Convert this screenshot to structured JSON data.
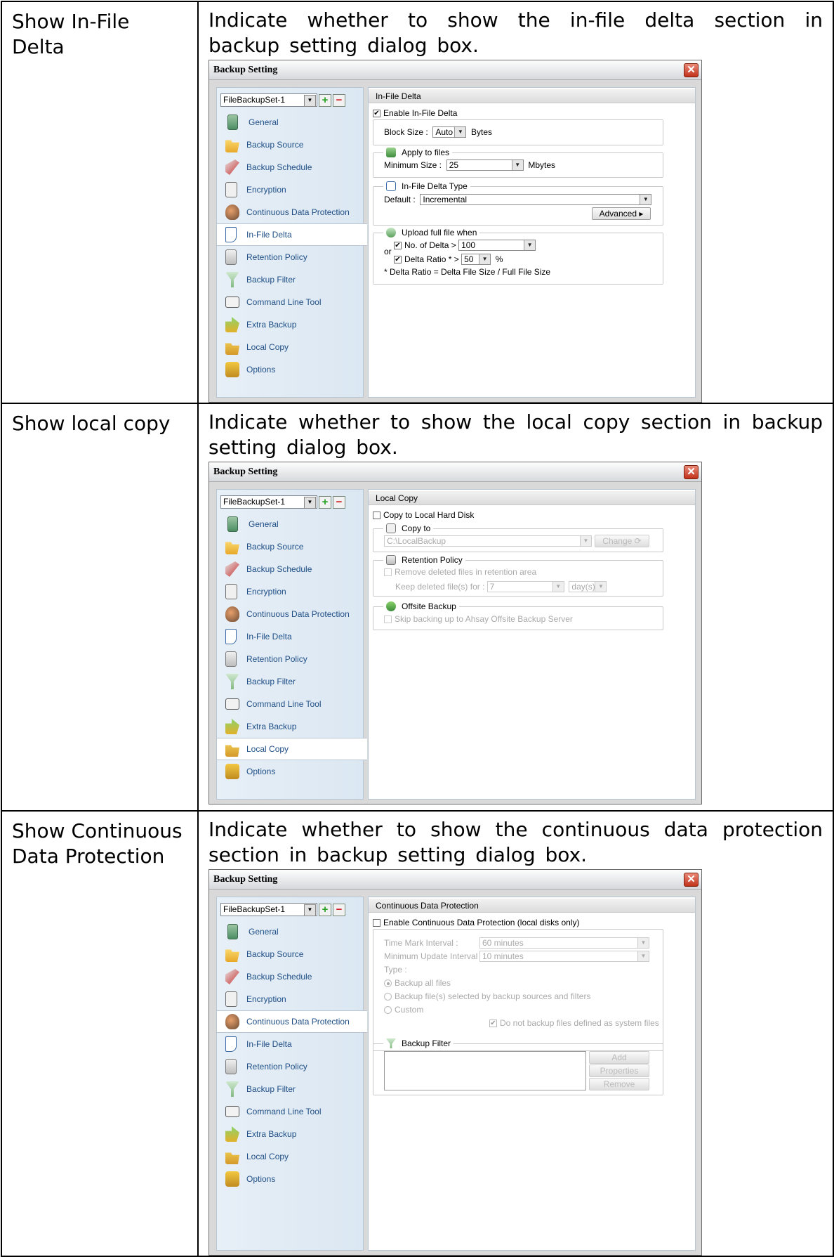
{
  "rows": [
    {
      "label": "Show In-File Delta",
      "desc_lines": [
        "Indicate whether to show the in-file delta section in",
        "backup setting dialog box."
      ],
      "dialog": {
        "title": "Backup Setting",
        "set_name": "FileBackupSet-1",
        "selected": "In-File Delta",
        "nav": [
          "General",
          "Backup Source",
          "Backup Schedule",
          "Encryption",
          "Continuous Data Protection",
          "In-File Delta",
          "Retention Policy",
          "Backup Filter",
          "Command Line Tool",
          "Extra Backup",
          "Local Copy",
          "Options"
        ],
        "panel_title": "In-File Delta",
        "enable_label": "Enable In-File Delta",
        "block_size_label": "Block Size :",
        "block_size_value": "Auto",
        "block_size_unit": "Bytes",
        "apply_title": "Apply to files",
        "min_size_label": "Minimum Size :",
        "min_size_value": "25",
        "min_size_unit": "Mbytes",
        "type_title": "In-File Delta Type",
        "default_label": "Default :",
        "default_value": "Incremental",
        "advanced_label": "Advanced",
        "upload_title": "Upload full file when",
        "no_delta_label": "No. of Delta >",
        "no_delta_value": "100",
        "or_label": "or",
        "ratio_label": "Delta Ratio * >",
        "ratio_value": "50",
        "ratio_unit": "%",
        "ratio_note": "* Delta Ratio = Delta File Size / Full File Size"
      }
    },
    {
      "label": "Show local copy",
      "desc_lines": [
        "Indicate whether to show the local copy section in backup",
        "setting dialog box."
      ],
      "dialog": {
        "title": "Backup Setting",
        "set_name": "FileBackupSet-1",
        "selected": "Local Copy",
        "nav": [
          "General",
          "Backup Source",
          "Backup Schedule",
          "Encryption",
          "Continuous Data Protection",
          "In-File Delta",
          "Retention Policy",
          "Backup Filter",
          "Command Line Tool",
          "Extra Backup",
          "Local Copy",
          "Options"
        ],
        "panel_title": "Local Copy",
        "copy_label": "Copy to Local Hard Disk",
        "copy_to_title": "Copy to",
        "path_value": "C:\\LocalBackup",
        "change_label": "Change",
        "retention_title": "Retention Policy",
        "remove_label": "Remove deleted files in retention area",
        "keep_label": "Keep deleted file(s) for :",
        "keep_value": "7",
        "keep_unit": "day(s)",
        "offsite_title": "Offsite Backup",
        "skip_label": "Skip backing up to Ahsay Offsite Backup Server"
      }
    },
    {
      "label": "Show Continuous Data Protection",
      "desc_lines": [
        "Indicate whether to show the continuous data protection",
        "section in backup setting dialog box."
      ],
      "dialog": {
        "title": "Backup Setting",
        "set_name": "FileBackupSet-1",
        "selected": "Continuous Data Protection",
        "nav": [
          "General",
          "Backup Source",
          "Backup Schedule",
          "Encryption",
          "Continuous Data Protection",
          "In-File Delta",
          "Retention Policy",
          "Backup Filter",
          "Command Line Tool",
          "Extra Backup",
          "Local Copy",
          "Options"
        ],
        "panel_title": "Continuous Data Protection",
        "enable_label": "Enable Continuous Data Protection (local disks only)",
        "time_mark_label": "Time Mark Interval :",
        "time_mark_value": "60 minutes",
        "min_update_label": "Minimum Update Interval :",
        "min_update_value": "10 minutes",
        "type_label": "Type :",
        "opt_all": "Backup all files",
        "opt_selected": "Backup file(s) selected by backup sources and filters",
        "opt_custom": "Custom",
        "system_files_label": "Do not backup files defined as system files",
        "filter_title": "Backup Filter",
        "add_label": "Add",
        "properties_label": "Properties",
        "remove_label": "Remove"
      }
    }
  ]
}
